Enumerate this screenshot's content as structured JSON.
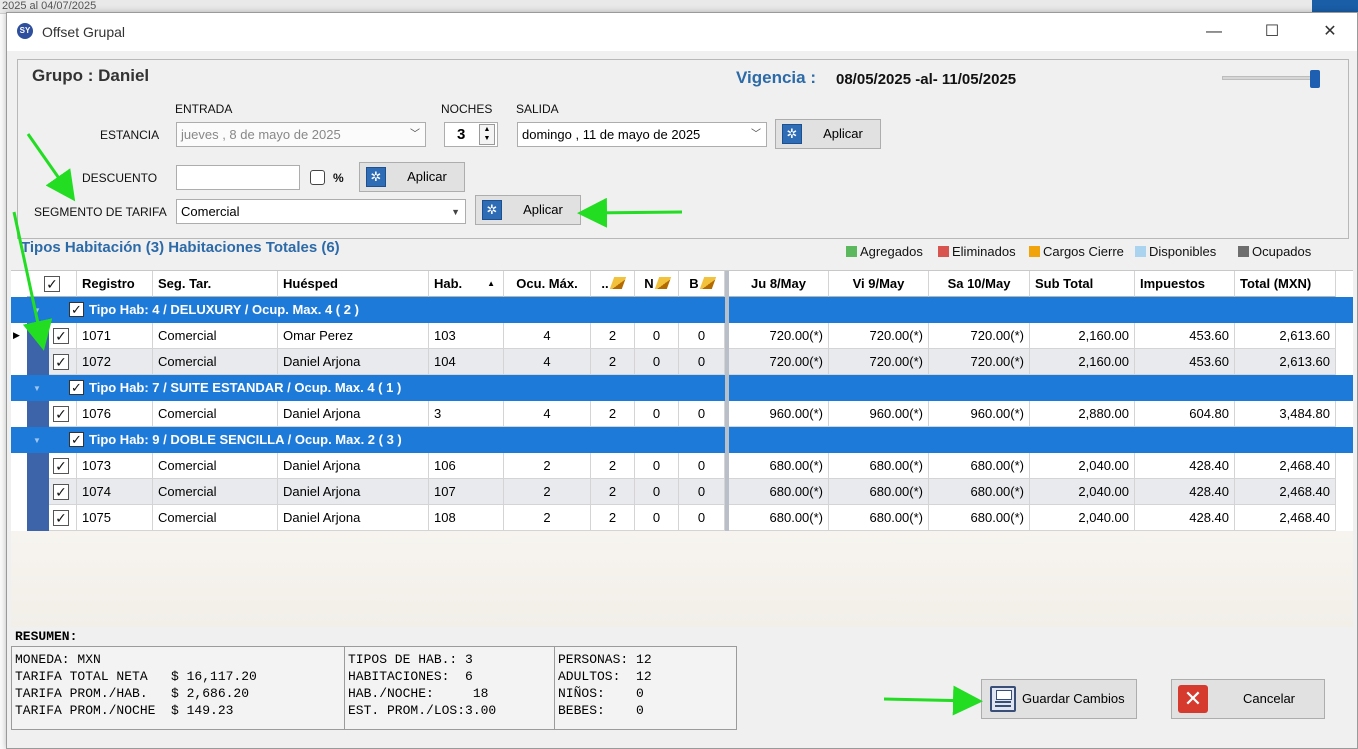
{
  "background": {
    "top_text": "2025 al 04/07/2025"
  },
  "window": {
    "title": "Offset Grupal",
    "app_icon": "SY",
    "minimize": "—",
    "maximize": "☐",
    "close": "✕"
  },
  "header": {
    "grupo": "Grupo : Daniel",
    "vigencia_label": "Vigencia :",
    "vigencia_value": "08/05/2025 -al- 11/05/2025",
    "entrada_label": "ENTRADA",
    "noches_label": "NOCHES",
    "salida_label": "SALIDA",
    "estancia_label": "ESTANCIA",
    "entrada_value": "jueves  ,   8 de     mayo      de 2025",
    "noches_value": "3",
    "salida_value": "domingo , 11 de     mayo      de 2025",
    "aplicar": "Aplicar",
    "descuento_label": "DESCUENTO",
    "descuento_value": "",
    "percent": "%",
    "segmento_label": "SEGMENTO DE TARIFA",
    "segmento_value": "Comercial"
  },
  "grid": {
    "title": "Tipos Habitación (3) Habitaciones Totales (6)",
    "legend": [
      {
        "label": "Agregados",
        "color": "#5cb85c"
      },
      {
        "label": "Eliminados",
        "color": "#d9534f"
      },
      {
        "label": "Cargos Cierre",
        "color": "#f0a30a"
      },
      {
        "label": "Disponibles",
        "color": "#a9d3ee"
      },
      {
        "label": "Ocupados",
        "color": "#6e6e6e"
      }
    ],
    "columns": [
      "Registro",
      "Seg. Tar.",
      "Huésped",
      "Hab.",
      "Ocu. Máx.",
      "..",
      "N",
      "B",
      "Ju 8/May",
      "Vi 9/May",
      "Sa 10/May",
      "Sub Total",
      "Impuestos",
      "Total (MXN)"
    ],
    "sort_arrow": "▲",
    "groups": [
      {
        "label": "Tipo Hab: 4 / DELUXURY / Ocup. Max. 4 ( 2 )",
        "rows": [
          [
            "1071",
            "Comercial",
            "Omar Perez",
            "103",
            "4",
            "2",
            "0",
            "0",
            "720.00(*)",
            "720.00(*)",
            "720.00(*)",
            "2,160.00",
            "453.60",
            "2,613.60"
          ],
          [
            "1072",
            "Comercial",
            "Daniel Arjona",
            "104",
            "4",
            "2",
            "0",
            "0",
            "720.00(*)",
            "720.00(*)",
            "720.00(*)",
            "2,160.00",
            "453.60",
            "2,613.60"
          ]
        ]
      },
      {
        "label": "Tipo Hab: 7 / SUITE ESTANDAR / Ocup. Max. 4 ( 1 )",
        "rows": [
          [
            "1076",
            "Comercial",
            "Daniel Arjona",
            "3",
            "4",
            "2",
            "0",
            "0",
            "960.00(*)",
            "960.00(*)",
            "960.00(*)",
            "2,880.00",
            "604.80",
            "3,484.80"
          ]
        ]
      },
      {
        "label": "Tipo Hab: 9 / DOBLE SENCILLA / Ocup. Max. 2 ( 3 )",
        "rows": [
          [
            "1073",
            "Comercial",
            "Daniel Arjona",
            "106",
            "2",
            "2",
            "0",
            "0",
            "680.00(*)",
            "680.00(*)",
            "680.00(*)",
            "2,040.00",
            "428.40",
            "2,468.40"
          ],
          [
            "1074",
            "Comercial",
            "Daniel Arjona",
            "107",
            "2",
            "2",
            "0",
            "0",
            "680.00(*)",
            "680.00(*)",
            "680.00(*)",
            "2,040.00",
            "428.40",
            "2,468.40"
          ],
          [
            "1075",
            "Comercial",
            "Daniel Arjona",
            "108",
            "2",
            "2",
            "0",
            "0",
            "680.00(*)",
            "680.00(*)",
            "680.00(*)",
            "2,040.00",
            "428.40",
            "2,468.40"
          ]
        ]
      }
    ]
  },
  "resumen": {
    "label": "RESUMEN:",
    "col1": [
      "MONEDA: MXN",
      "TARIFA TOTAL NETA   $ 16,117.20",
      "TARIFA PROM./HAB.   $ 2,686.20",
      "TARIFA PROM./NOCHE  $ 149.23"
    ],
    "col2": [
      "TIPOS DE HAB.: 3",
      "HABITACIONES:  6",
      "HAB./NOCHE:     18",
      "EST. PROM./LOS:3.00"
    ],
    "col3": [
      "PERSONAS: 12",
      "ADULTOS:  12",
      "NIÑOS:    0",
      "BEBES:    0"
    ]
  },
  "actions": {
    "guardar": "Guardar Cambios",
    "cancelar": "Cancelar"
  },
  "colors": {
    "accent_blue": "#2c6aa8",
    "group_row": "#1e7ad9",
    "annotation_green": "#22dd22"
  }
}
